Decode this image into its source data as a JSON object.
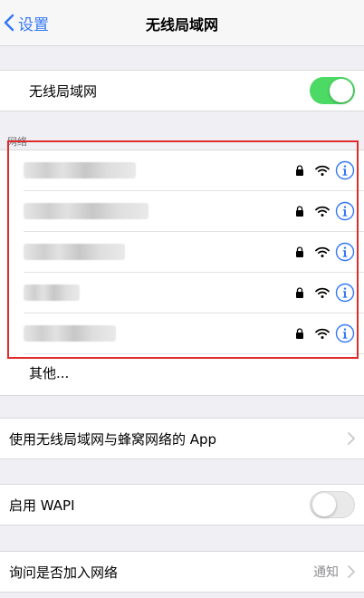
{
  "nav": {
    "back_label": "设置",
    "title": "无线局域网"
  },
  "wlan_toggle": {
    "label": "无线局域网",
    "state": "on"
  },
  "networks": {
    "header": "网络",
    "items": [
      {
        "name": "",
        "secured": true
      },
      {
        "name": "",
        "secured": true
      },
      {
        "name": "",
        "secured": true
      },
      {
        "name": "",
        "secured": true
      },
      {
        "name": "",
        "secured": true
      }
    ],
    "other_label": "其他..."
  },
  "apps_row": {
    "label": "使用无线局域网与蜂窝网络的 App"
  },
  "wapi_row": {
    "label": "启用 WAPI",
    "state": "off"
  },
  "ask_row": {
    "label": "询问是否加入网络",
    "value": "通知"
  },
  "colors": {
    "accent": "#3478f6",
    "toggle_on": "#4cd964",
    "highlight": "#e02b2b"
  }
}
